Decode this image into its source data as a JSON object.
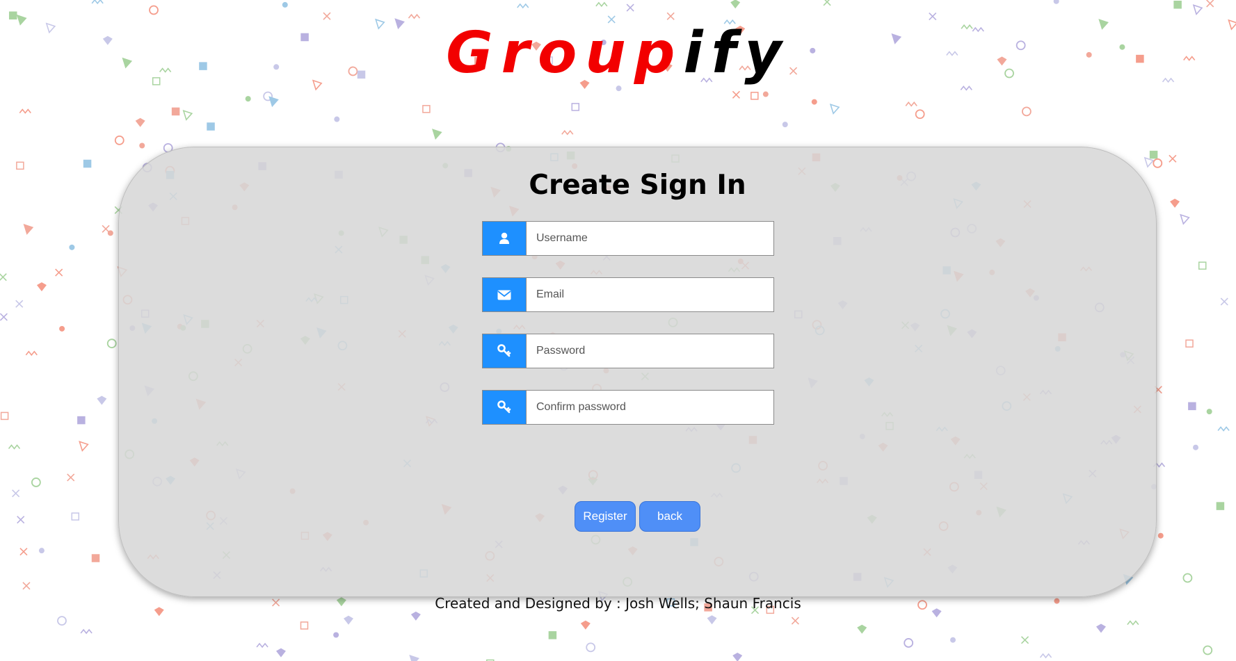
{
  "brand": {
    "logo_part_a": "Groupify",
    "logo_part_b": ""
  },
  "form": {
    "title": "Create Sign In",
    "fields": [
      {
        "icon": "user-icon",
        "placeholder": "Username",
        "value": ""
      },
      {
        "icon": "envelope-icon",
        "placeholder": "Email",
        "value": ""
      },
      {
        "icon": "key-icon",
        "placeholder": "Password",
        "value": ""
      },
      {
        "icon": "key-icon",
        "placeholder": "Confirm password",
        "value": ""
      }
    ],
    "register_label": "Register",
    "back_label": "back"
  },
  "footer": {
    "credit": "Created and Designed by : Josh Wells; Shaun Francis"
  },
  "colors": {
    "logo_red": "#f20000",
    "logo_black": "#000000",
    "icon_bg": "#1e90ff",
    "button_bg": "#4f8ff7",
    "panel_bg": "#d6d6d6"
  }
}
